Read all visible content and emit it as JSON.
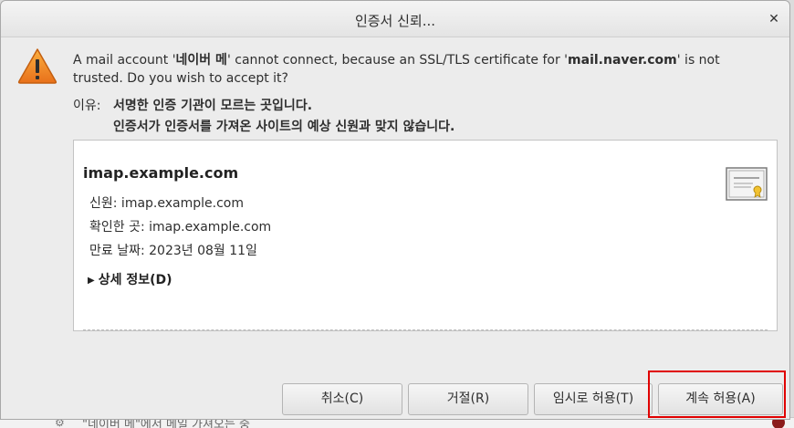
{
  "dialog": {
    "title": "인증서 신뢰...",
    "close_glyph": "✕"
  },
  "message": {
    "part1": "A mail account '",
    "account": "네이버 메",
    "part2": "' cannot connect, because an SSL/TLS certificate for '",
    "server": "mail.naver.com",
    "part3": "' is not trusted. Do you wish to accept it?"
  },
  "reason": {
    "label": "이유:",
    "line1": "서명한 인증 기관이 모르는 곳입니다.",
    "line2": "인증서가 인증서를 가져온 사이트의 예상 신원과 맞지 않습니다."
  },
  "certificate": {
    "host": "imap.example.com",
    "identity": "신원: imap.example.com",
    "verified_by": "확인한 곳: imap.example.com",
    "expires": "만료 날짜: 2023년 08월 11일",
    "details_label": "상세 정보(D)",
    "details_glyph": "▶"
  },
  "buttons": {
    "cancel": "취소(C)",
    "reject": "거절(R)",
    "accept_temp": "임시로 허용(T)",
    "accept_perm": "계속 허용(A)"
  },
  "background": {
    "peek_text": "\"네이버 메\"에서 메일 가져오는 중",
    "peek_icon": "⚙"
  },
  "colors": {
    "warning": "#f08a1c",
    "highlight": "#e00000"
  }
}
